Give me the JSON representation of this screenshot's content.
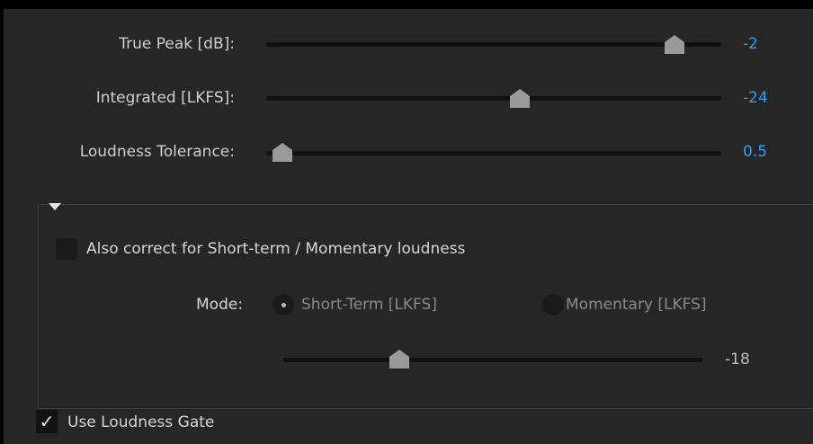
{
  "sliders": [
    {
      "label": "True Peak [dB]:",
      "value": "-2",
      "position": 0.88
    },
    {
      "label": "Integrated [LKFS]:",
      "value": "-24",
      "position": 0.55
    },
    {
      "label": "Loudness Tolerance:",
      "value": "0.5",
      "position": 0.0
    }
  ],
  "section": {
    "expand_icon": "triangle-down-icon",
    "correct_checkbox": {
      "label": "Also correct for Short-term / Momentary loudness",
      "checked": false
    },
    "mode": {
      "label": "Mode:",
      "options": [
        {
          "label": "Short-Term [LKFS]",
          "selected": true
        },
        {
          "label": "Momentary [LKFS]",
          "selected": false
        }
      ]
    },
    "short_term_slider": {
      "value": "-18",
      "position": 0.28
    }
  },
  "gate_checkbox": {
    "label": "Use Loudness Gate",
    "checked": true,
    "mark": "✓"
  },
  "colors": {
    "background": "#262626",
    "accent_value": "#2d9ff0",
    "thumb": "#9a9a9a"
  }
}
